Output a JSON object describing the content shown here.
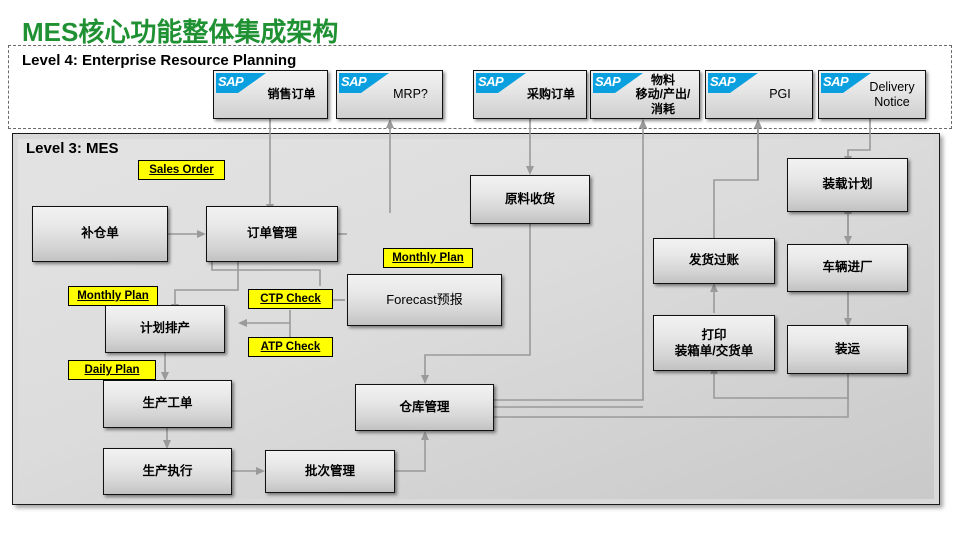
{
  "page": {
    "title": "MES核心功能整体集成架构",
    "title_color": "#1f9133",
    "accent_yellow": "#ffff00",
    "sap_blue": "#0aa0e0",
    "connector_color": "#9a9a9a"
  },
  "levels": {
    "level4": {
      "label": "Level 4: Enterprise Resource Planning"
    },
    "level3": {
      "label": "Level 3: MES"
    }
  },
  "erp_boxes": [
    {
      "id": "sales-order",
      "logo": "SAP",
      "label": "销售订单"
    },
    {
      "id": "mrp",
      "logo": "SAP",
      "label": "MRP?"
    },
    {
      "id": "purchase-order",
      "logo": "SAP",
      "label": "采购订单"
    },
    {
      "id": "material-movement",
      "logo": "SAP",
      "label": "物料\n移动/产出/消耗"
    },
    {
      "id": "pgi",
      "logo": "SAP",
      "label": "PGI"
    },
    {
      "id": "delivery-notice",
      "logo": "SAP",
      "label": "Delivery\nNotice"
    }
  ],
  "mes_boxes": [
    {
      "id": "replenishment-order",
      "label": "补仓单"
    },
    {
      "id": "order-management",
      "label": "订单管理"
    },
    {
      "id": "material-receipt",
      "label": "原料收货"
    },
    {
      "id": "loading-plan",
      "label": "装载计划"
    },
    {
      "id": "forecast",
      "label": "Forecast预报"
    },
    {
      "id": "production-planning",
      "label": "计划排产"
    },
    {
      "id": "delivery-posting",
      "label": "发货过账"
    },
    {
      "id": "vehicle-entry",
      "label": "车辆进厂"
    },
    {
      "id": "print-packing-list",
      "label": "打印\n装箱单/交货单"
    },
    {
      "id": "shipping",
      "label": "装运"
    },
    {
      "id": "production-work-order",
      "label": "生产工单"
    },
    {
      "id": "warehouse-management",
      "label": "仓库管理"
    },
    {
      "id": "production-execution",
      "label": "生产执行"
    },
    {
      "id": "batch-management",
      "label": "批次管理"
    }
  ],
  "annotations": [
    {
      "id": "sales-order-note",
      "label": "Sales Order"
    },
    {
      "id": "monthly-plan-left",
      "label": "Monthly Plan"
    },
    {
      "id": "monthly-plan-right",
      "label": "Monthly Plan"
    },
    {
      "id": "daily-plan",
      "label": "Daily Plan"
    },
    {
      "id": "ctp-check",
      "label": "CTP Check"
    },
    {
      "id": "atp-check",
      "label": "ATP Check"
    }
  ]
}
